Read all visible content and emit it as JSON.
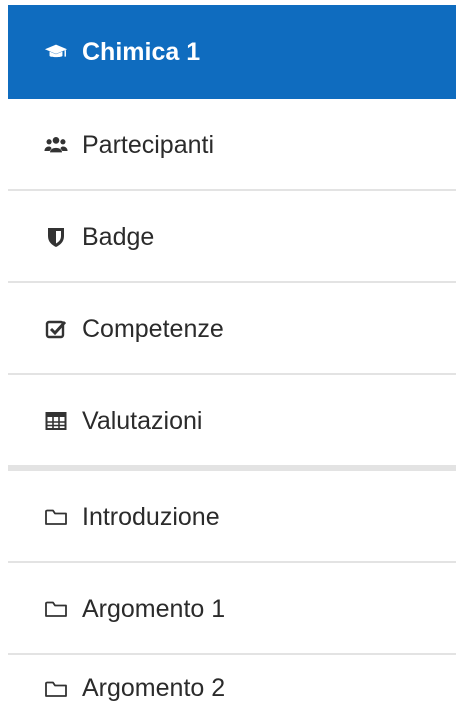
{
  "nav": {
    "course": {
      "label": "Chimica 1",
      "icon": "graduation-cap-icon"
    },
    "items": [
      {
        "label": "Partecipanti",
        "icon": "users-icon"
      },
      {
        "label": "Badge",
        "icon": "shield-icon"
      },
      {
        "label": "Competenze",
        "icon": "check-square-icon"
      },
      {
        "label": "Valutazioni",
        "icon": "table-icon"
      }
    ],
    "sections": [
      {
        "label": "Introduzione",
        "icon": "folder-icon"
      },
      {
        "label": "Argomento 1",
        "icon": "folder-icon"
      },
      {
        "label": "Argomento 2",
        "icon": "folder-icon"
      }
    ]
  },
  "colors": {
    "active_background": "#0f6cbf",
    "divider": "#e3e3e3",
    "text": "#2b2b2b"
  }
}
